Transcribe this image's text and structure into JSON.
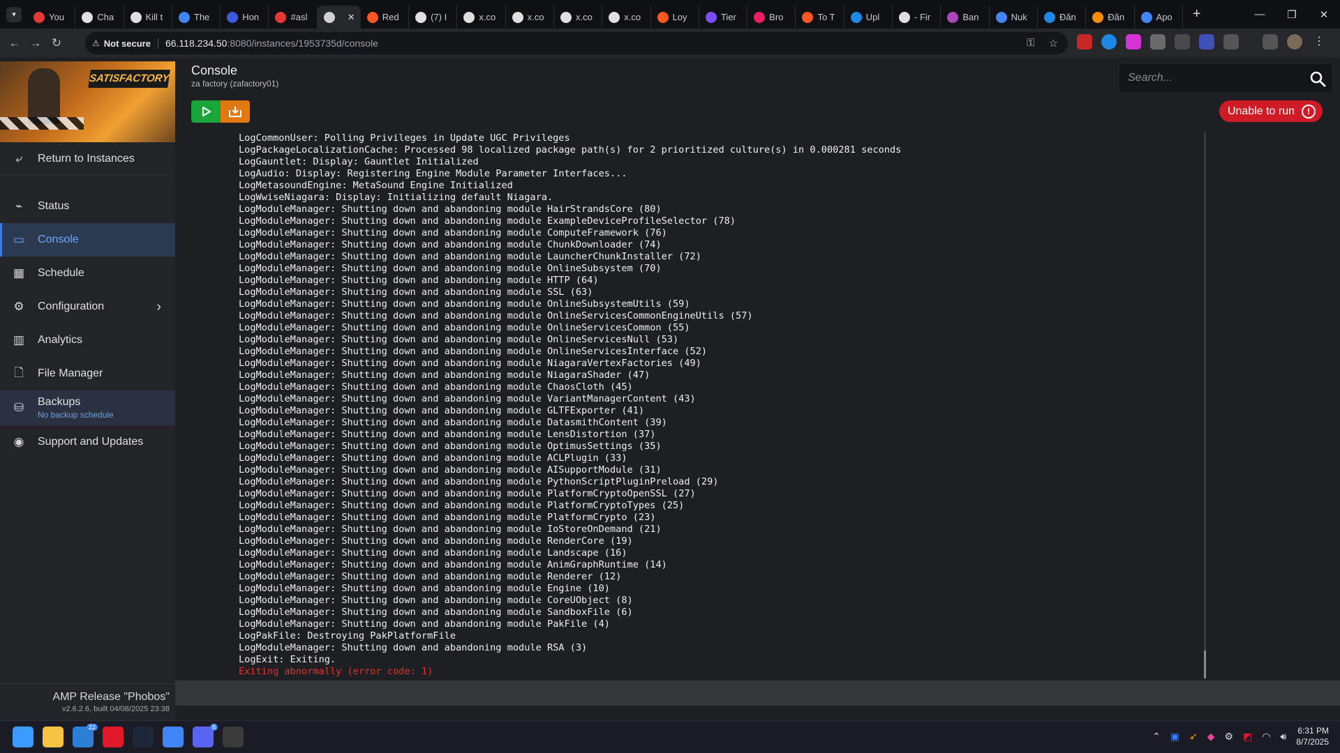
{
  "browser": {
    "tabs": [
      {
        "title": "You",
        "color": "#e53935"
      },
      {
        "title": "Cha",
        "color": "#e0e0e0"
      },
      {
        "title": "Kill t",
        "color": "#e0e0e0"
      },
      {
        "title": "The",
        "color": "#4285f4"
      },
      {
        "title": "Hon",
        "color": "#3b5bdb"
      },
      {
        "title": "#asl",
        "color": "#e53935"
      },
      {
        "title": "",
        "color": "#d0d0d0",
        "active": true
      },
      {
        "title": "Red",
        "color": "#ff5722"
      },
      {
        "title": "(7) I",
        "color": "#e0e0e0"
      },
      {
        "title": "x.co",
        "color": "#e0e0e0"
      },
      {
        "title": "x.co",
        "color": "#e0e0e0"
      },
      {
        "title": "x.co",
        "color": "#e0e0e0"
      },
      {
        "title": "x.co",
        "color": "#e0e0e0"
      },
      {
        "title": "Loy",
        "color": "#ff5722"
      },
      {
        "title": "Tier",
        "color": "#7c4dff"
      },
      {
        "title": "Bro",
        "color": "#e91e63"
      },
      {
        "title": "To T",
        "color": "#ff5722"
      },
      {
        "title": "Upl",
        "color": "#1e88e5"
      },
      {
        "title": "- Fir",
        "color": "#e0e0e0"
      },
      {
        "title": "Ban",
        "color": "#ab47bc"
      },
      {
        "title": "Nuk",
        "color": "#4285f4"
      },
      {
        "title": "Đăn",
        "color": "#1e88e5"
      },
      {
        "title": "Đăn",
        "color": "#fb8c00"
      },
      {
        "title": "Apo",
        "color": "#4285f4"
      }
    ],
    "not_secure": "Not secure",
    "url_host": "66.118.234.50",
    "url_rest": ":8080/instances/1953735d/console"
  },
  "sidebar": {
    "banner_logo": "SATISFACTORY",
    "return_label": "Return to Instances",
    "items": [
      {
        "label": "Status",
        "icon": "status-chart-icon"
      },
      {
        "label": "Console",
        "icon": "terminal-icon"
      },
      {
        "label": "Schedule",
        "icon": "calendar-icon"
      },
      {
        "label": "Configuration",
        "icon": "gears-icon"
      },
      {
        "label": "Analytics",
        "icon": "bar-chart-icon"
      },
      {
        "label": "File Manager",
        "icon": "file-icon"
      },
      {
        "label": "Backups",
        "sub": "No backup schedule",
        "icon": "database-icon"
      },
      {
        "label": "Support and Updates",
        "icon": "lifebuoy-icon"
      }
    ],
    "footer": {
      "release": "AMP Release \"Phobos\"",
      "version": "v2.6.2.6, built 04/08/2025 23:38"
    }
  },
  "header": {
    "title": "Console",
    "subtitle": "za factory (zafactory01)",
    "search_placeholder": "Search..."
  },
  "status": {
    "label": "Unable to run",
    "color": "#cf1b26"
  },
  "console": {
    "lines": [
      "LogCommonUser: Polling Privileges in Update UGC Privileges",
      "LogPackageLocalizationCache: Processed 98 localized package path(s) for 2 prioritized culture(s) in 0.000281 seconds",
      "LogGauntlet: Display: Gauntlet Initialized",
      "LogAudio: Display: Registering Engine Module Parameter Interfaces...",
      "LogMetasoundEngine: MetaSound Engine Initialized",
      "LogWwiseNiagara: Display: Initializing default Niagara.",
      "LogModuleManager: Shutting down and abandoning module HairStrandsCore (80)",
      "LogModuleManager: Shutting down and abandoning module ExampleDeviceProfileSelector (78)",
      "LogModuleManager: Shutting down and abandoning module ComputeFramework (76)",
      "LogModuleManager: Shutting down and abandoning module ChunkDownloader (74)",
      "LogModuleManager: Shutting down and abandoning module LauncherChunkInstaller (72)",
      "LogModuleManager: Shutting down and abandoning module OnlineSubsystem (70)",
      "LogModuleManager: Shutting down and abandoning module HTTP (64)",
      "LogModuleManager: Shutting down and abandoning module SSL (63)",
      "LogModuleManager: Shutting down and abandoning module OnlineSubsystemUtils (59)",
      "LogModuleManager: Shutting down and abandoning module OnlineServicesCommonEngineUtils (57)",
      "LogModuleManager: Shutting down and abandoning module OnlineServicesCommon (55)",
      "LogModuleManager: Shutting down and abandoning module OnlineServicesNull (53)",
      "LogModuleManager: Shutting down and abandoning module OnlineServicesInterface (52)",
      "LogModuleManager: Shutting down and abandoning module NiagaraVertexFactories (49)",
      "LogModuleManager: Shutting down and abandoning module NiagaraShader (47)",
      "LogModuleManager: Shutting down and abandoning module ChaosCloth (45)",
      "LogModuleManager: Shutting down and abandoning module VariantManagerContent (43)",
      "LogModuleManager: Shutting down and abandoning module GLTFExporter (41)",
      "LogModuleManager: Shutting down and abandoning module DatasmithContent (39)",
      "LogModuleManager: Shutting down and abandoning module LensDistortion (37)",
      "LogModuleManager: Shutting down and abandoning module OptimusSettings (35)",
      "LogModuleManager: Shutting down and abandoning module ACLPlugin (33)",
      "LogModuleManager: Shutting down and abandoning module AISupportModule (31)",
      "LogModuleManager: Shutting down and abandoning module PythonScriptPluginPreload (29)",
      "LogModuleManager: Shutting down and abandoning module PlatformCryptoOpenSSL (27)",
      "LogModuleManager: Shutting down and abandoning module PlatformCryptoTypes (25)",
      "LogModuleManager: Shutting down and abandoning module PlatformCrypto (23)",
      "LogModuleManager: Shutting down and abandoning module IoStoreOnDemand (21)",
      "LogModuleManager: Shutting down and abandoning module RenderCore (19)",
      "LogModuleManager: Shutting down and abandoning module Landscape (16)",
      "LogModuleManager: Shutting down and abandoning module AnimGraphRuntime (14)",
      "LogModuleManager: Shutting down and abandoning module Renderer (12)",
      "LogModuleManager: Shutting down and abandoning module Engine (10)",
      "LogModuleManager: Shutting down and abandoning module CoreUObject (8)",
      "LogModuleManager: Shutting down and abandoning module SandboxFile (6)",
      "LogModuleManager: Shutting down and abandoning module PakFile (4)",
      "LogPakFile: Destroying PakPlatformFile",
      "LogModuleManager: Shutting down and abandoning module RSA (3)",
      "LogExit: Exiting."
    ],
    "error_line": "Exiting abnormally (error code: 1)",
    "error_color": "#e8332c"
  },
  "taskbar": {
    "apps": [
      {
        "name": "windows-start-icon",
        "color": "#3b9cff"
      },
      {
        "name": "file-explorer-icon",
        "color": "#f5c242"
      },
      {
        "name": "weather-icon",
        "color": "#2d7fd6",
        "badge": "22"
      },
      {
        "name": "amd-icon",
        "color": "#e0182c"
      },
      {
        "name": "steam-icon",
        "color": "#1b2838"
      },
      {
        "name": "chrome-icon",
        "color": "#4285f4"
      },
      {
        "name": "discord-icon",
        "color": "#5865f2",
        "badge": "8"
      },
      {
        "name": "smm-icon",
        "color": "#3a3a3a"
      }
    ],
    "time": "6:31 PM",
    "date": "8/7/2025"
  }
}
